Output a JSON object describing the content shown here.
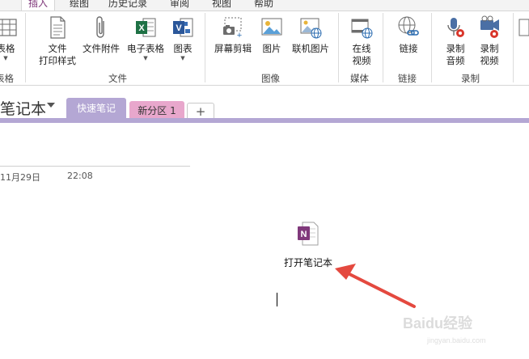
{
  "menu": {
    "tabs": [
      {
        "label": "插入",
        "active": true
      },
      {
        "label": "绘图"
      },
      {
        "label": "历史记录"
      },
      {
        "label": "审阅"
      },
      {
        "label": "视图"
      },
      {
        "label": "帮助"
      }
    ]
  },
  "ribbon": {
    "groups": {
      "table": {
        "label": "表格",
        "buttons": {
          "table": "表格"
        }
      },
      "file": {
        "label": "文件",
        "buttons": {
          "printout_line1": "文件",
          "printout_line2": "打印样式",
          "attachment": "文件附件",
          "spreadsheet": "电子表格",
          "diagram": "图表"
        }
      },
      "image": {
        "label": "图像",
        "buttons": {
          "screen_clip": "屏幕剪辑",
          "pictures": "图片",
          "online_pictures": "联机图片"
        }
      },
      "media": {
        "label": "媒体",
        "buttons": {
          "online_video_line1": "在线",
          "online_video_line2": "视频"
        }
      },
      "links": {
        "label": "链接",
        "buttons": {
          "link": "链接"
        }
      },
      "record": {
        "label": "录制",
        "buttons": {
          "audio_line1": "录制",
          "audio_line2": "音频",
          "video_line1": "录制",
          "video_line2": "视频"
        }
      }
    }
  },
  "notebook": {
    "name": "笔记本",
    "sections": [
      {
        "label": "快速笔记",
        "active": true
      },
      {
        "label": "新分区 1"
      }
    ],
    "add_section": "+"
  },
  "page": {
    "date": "11月29日",
    "time": "22:08",
    "attachment_label": "打开笔记本"
  },
  "colors": {
    "accent": "#80397b",
    "section_quick": "#b4a7d4",
    "section_new": "#e8a7cc",
    "annotation_arrow": "#e4493f"
  },
  "watermark": {
    "text": "Baidu经验",
    "sub": "jingyan.baidu.com"
  }
}
